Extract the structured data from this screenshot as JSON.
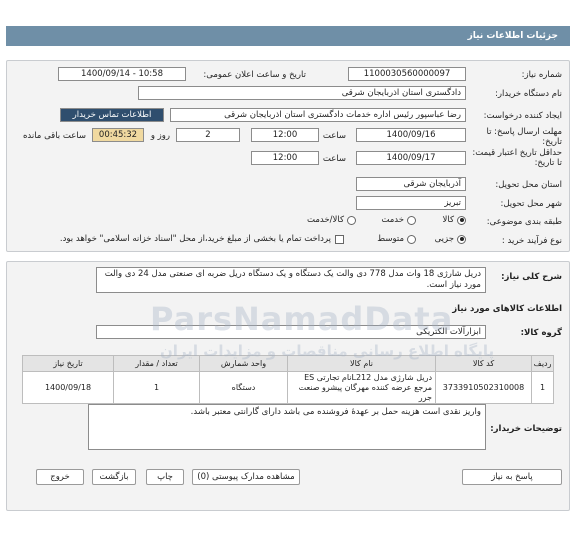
{
  "page_title": "جزئیات اطلاعات نیاز",
  "fields": {
    "need_number_label": "شماره نیاز:",
    "need_number": "1100030560000097",
    "announce_label": "تاریخ و ساعت اعلان عمومی:",
    "announce_value": "1400/09/14 - 10:58",
    "buyer_org_label": "نام دستگاه خریدار:",
    "buyer_org": "دادگستری استان اذربایجان شرقی",
    "creator_label": "ایجاد کننده درخواست:",
    "creator": "رضا عباسپور رئیس اداره خدمات دادگستری استان اذربایجان شرقی",
    "contact_link": "اطلاعات تماس خریدار",
    "deadline_label": "مهلت ارسال پاسخ: تا تاریخ:",
    "deadline_date": "1400/09/16",
    "time_label": "ساعت",
    "deadline_time": "12:00",
    "days_value": "2",
    "days_label": "روز و",
    "remaining_time": "00:45:32",
    "remaining_label": "ساعت باقی مانده",
    "validity_label": "حداقل تاریخ اعتبار قیمت: تا تاریخ:",
    "validity_date": "1400/09/17",
    "validity_time": "12:00",
    "province_label": "استان محل تحویل:",
    "province": "آذربایجان شرقی",
    "city_label": "شهر محل تحویل:",
    "city": "تبریز",
    "category_label": "طبقه بندی موضوعی:",
    "category_options": [
      "کالا",
      "خدمت",
      "کالا/خدمت"
    ],
    "process_label": "نوع فرآیند خرید :",
    "process_options": [
      "جزیی",
      "متوسط"
    ],
    "payment_note": "پرداخت تمام یا بخشی از مبلغ خرید،از محل \"اسناد خزانه اسلامی\" خواهد بود."
  },
  "summary": {
    "label": "شرح کلی نیاز:",
    "text": "دریل شارژی 18 وات مدل 778 دی والت یک دستگاه و یک دستگاه دریل ضربه ای صنعتی مدل 24 دی والت مورد نیاز است."
  },
  "goods": {
    "section_title": "اطلاعات کالاهای مورد نیاز",
    "group_label": "گروه کالا:",
    "group_value": "ابزارآلات الکتریکی",
    "headers": [
      "ردیف",
      "کد کالا",
      "نام کالا",
      "واحد شمارش",
      "تعداد / مقدار",
      "تاریخ نیاز"
    ],
    "rows": [
      {
        "row": "1",
        "code": "3733910502310008",
        "name": "دریل شارژی مدل L212نام تجارتی ES مرجع عرضه کننده مهرگان پیشرو صنعت جرر",
        "unit": "دستگاه",
        "qty": "1",
        "date": "1400/09/18"
      }
    ]
  },
  "buyer_notes": {
    "label": "توضیحات خریدار:",
    "text": "واریز نقدی است هزینه حمل بر عهدهٔ فروشنده می باشد دارای گارانتی معتبر باشد."
  },
  "buttons": {
    "reply": "پاسخ به نیاز",
    "attachments": "مشاهده مدارک پیوستی (0)",
    "print": "چاپ",
    "back": "بازگشت",
    "exit": "خروج"
  },
  "watermark": {
    "main": "ParsNamadData",
    "sub": "پایگاه اطلاع رسانی مناقصات و مزایدات ایران"
  }
}
